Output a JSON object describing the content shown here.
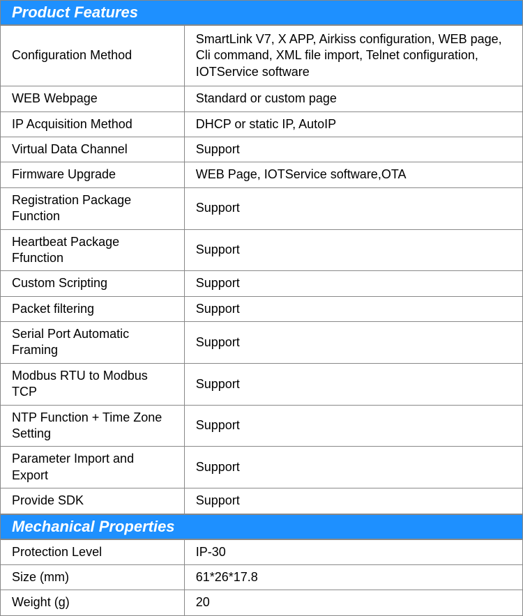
{
  "sections": [
    {
      "title": "Product Features",
      "rows": [
        {
          "label": "Configuration Method",
          "value": "SmartLink V7, X APP, Airkiss configuration, WEB page, Cli command, XML file import, Telnet configuration, IOTService software",
          "tall": true
        },
        {
          "label": "WEB Webpage",
          "value": "Standard or custom page"
        },
        {
          "label": "IP Acquisition Method",
          "value": "DHCP or static IP, AutoIP"
        },
        {
          "label": "Virtual Data Channel",
          "value": "Support"
        },
        {
          "label": "Firmware Upgrade",
          "value": "WEB Page, IOTService software,OTA"
        },
        {
          "label": "Registration Package Function",
          "value": "Support"
        },
        {
          "label": "Heartbeat Package Ffunction",
          "value": "Support"
        },
        {
          "label": "Custom Scripting",
          "value": "Support"
        },
        {
          "label": "Packet filtering",
          "value": "Support"
        },
        {
          "label": "Serial Port Automatic Framing",
          "value": "Support"
        },
        {
          "label": "Modbus RTU to Modbus TCP",
          "value": "Support"
        },
        {
          "label": "NTP Function + Time Zone Setting",
          "value": "Support"
        },
        {
          "label": "Parameter Import and Export",
          "value": "Support"
        },
        {
          "label": "Provide SDK",
          "value": "Support"
        }
      ]
    },
    {
      "title": "Mechanical Properties",
      "rows": [
        {
          "label": "Protection Level",
          "value": "IP-30"
        },
        {
          "label": "Size (mm)",
          "value": "61*26*17.8"
        },
        {
          "label": "Weight (g)",
          "value": "20"
        }
      ]
    }
  ]
}
